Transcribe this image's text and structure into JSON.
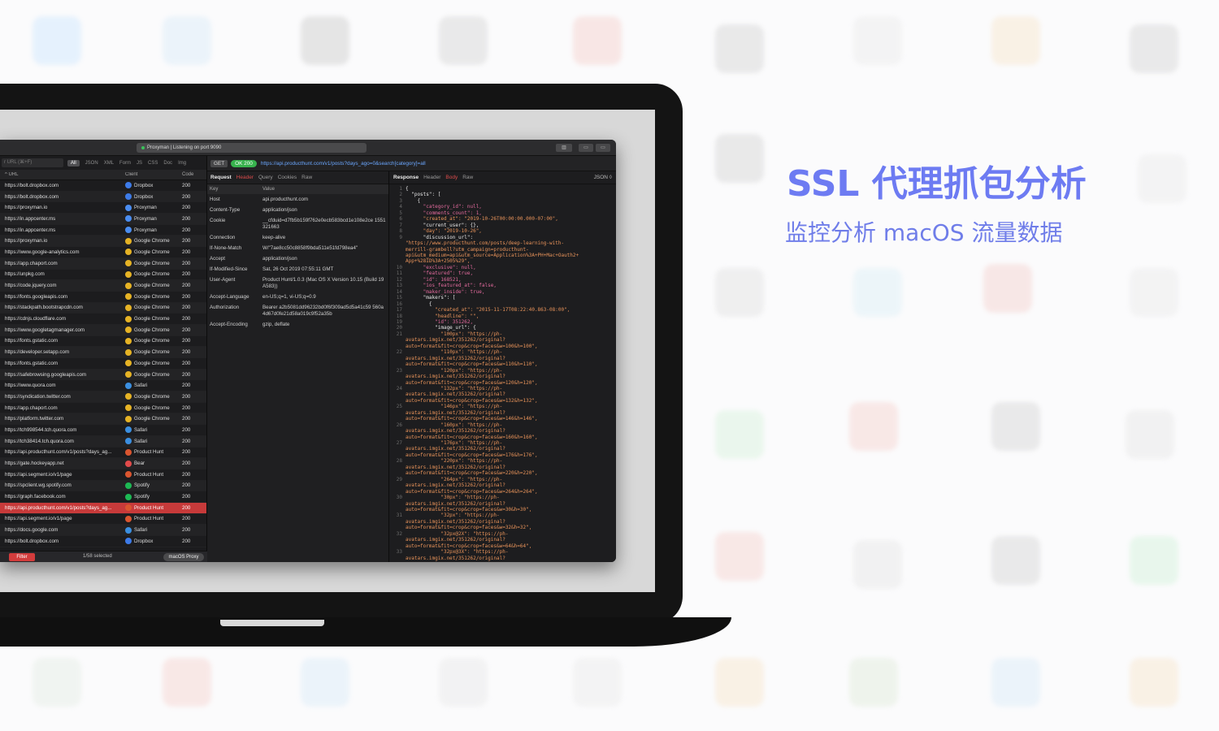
{
  "hero": {
    "headline": "SSL 代理抓包分析",
    "subhead": "监控分析 macOS 流量数据"
  },
  "window": {
    "title": "Proxyman | Listening on port 9090"
  },
  "filterbar": {
    "search_placeholder": "r URL (⌘+F)",
    "tabs": [
      "All",
      "JSON",
      "XML",
      "Form",
      "JS",
      "CSS",
      "Doc",
      "Img"
    ]
  },
  "list": {
    "columns": {
      "url": "URL",
      "client": "Client",
      "code": "Code"
    },
    "rows": [
      {
        "url": "https://bolt.dropbox.com",
        "client": "Dropbox",
        "code": "200"
      },
      {
        "url": "https://bolt.dropbox.com",
        "client": "Dropbox",
        "code": "200"
      },
      {
        "url": "https://proxyman.io",
        "client": "Proxyman",
        "code": "200"
      },
      {
        "url": "https://in.appcenter.ms",
        "client": "Proxyman",
        "code": "200"
      },
      {
        "url": "https://in.appcenter.ms",
        "client": "Proxyman",
        "code": "200"
      },
      {
        "url": "https://proxyman.io",
        "client": "Google Chrome",
        "code": "200"
      },
      {
        "url": "https://www.google-analytics.com",
        "client": "Google Chrome",
        "code": "200"
      },
      {
        "url": "https://app.chaport.com",
        "client": "Google Chrome",
        "code": "200"
      },
      {
        "url": "https://unpkg.com",
        "client": "Google Chrome",
        "code": "200"
      },
      {
        "url": "https://code.jquery.com",
        "client": "Google Chrome",
        "code": "200"
      },
      {
        "url": "https://fonts.googleapis.com",
        "client": "Google Chrome",
        "code": "200"
      },
      {
        "url": "https://stackpath.bootstrapcdn.com",
        "client": "Google Chrome",
        "code": "200"
      },
      {
        "url": "https://cdnjs.cloudflare.com",
        "client": "Google Chrome",
        "code": "200"
      },
      {
        "url": "https://www.googletagmanager.com",
        "client": "Google Chrome",
        "code": "200"
      },
      {
        "url": "https://fonts.gstatic.com",
        "client": "Google Chrome",
        "code": "200"
      },
      {
        "url": "https://developer.setapp.com",
        "client": "Google Chrome",
        "code": "200"
      },
      {
        "url": "https://fonts.gstatic.com",
        "client": "Google Chrome",
        "code": "200"
      },
      {
        "url": "https://safebrowsing.googleapis.com",
        "client": "Google Chrome",
        "code": "200"
      },
      {
        "url": "https://www.quora.com",
        "client": "Safari",
        "code": "200"
      },
      {
        "url": "https://syndication.twitter.com",
        "client": "Google Chrome",
        "code": "200"
      },
      {
        "url": "https://app.chaport.com",
        "client": "Google Chrome",
        "code": "200"
      },
      {
        "url": "https://platform.twitter.com",
        "client": "Google Chrome",
        "code": "200"
      },
      {
        "url": "https://tch998544.tch.quora.com",
        "client": "Safari",
        "code": "200"
      },
      {
        "url": "https://tch38414.tch.quora.com",
        "client": "Safari",
        "code": "200"
      },
      {
        "url": "https://api.producthunt.com/v1/posts?days_ag...",
        "client": "Product Hunt",
        "code": "200"
      },
      {
        "url": "https://gate.hockeyapp.net",
        "client": "Bear",
        "code": "200"
      },
      {
        "url": "https://api.segment.io/v1/page",
        "client": "Product Hunt",
        "code": "200"
      },
      {
        "url": "https://spclient.wg.spotify.com",
        "client": "Spotify",
        "code": "200"
      },
      {
        "url": "https://graph.facebook.com",
        "client": "Spotify",
        "code": "200"
      },
      {
        "url": "https://api.producthunt.com/v1/posts?days_ag...",
        "client": "Product Hunt",
        "code": "200"
      },
      {
        "url": "https://api.segment.io/v1/page",
        "client": "Product Hunt",
        "code": "200"
      },
      {
        "url": "https://docs.google.com",
        "client": "Safari",
        "code": "200"
      },
      {
        "url": "https://bolt.dropbox.com",
        "client": "Dropbox",
        "code": "200"
      }
    ],
    "selected_index": 29
  },
  "client_colors": {
    "Dropbox": "#3d7be8",
    "Proxyman": "#4a8df0",
    "Google Chrome": "#e6b325",
    "Safari": "#3b8fe0",
    "Product Hunt": "#da552f",
    "Bear": "#e24b4b",
    "Spotify": "#1db954"
  },
  "footer": {
    "filter_label": "Filter",
    "selected_text": "1/58 selected",
    "proxy_label": "macOS Proxy"
  },
  "request_bar": {
    "method": "GET",
    "status": "OK 200",
    "url": "https://api.producthunt.com/v1/posts?days_ago=0&search[category]=all"
  },
  "request_pane": {
    "tabs": [
      "Request",
      "Header",
      "Query",
      "Cookies",
      "Raw"
    ],
    "key_header": "Key",
    "value_header": "Value",
    "headers": [
      {
        "key": "Host",
        "value": "api.producthunt.com"
      },
      {
        "key": "Content-Type",
        "value": "application/json"
      },
      {
        "key": "Cookie",
        "value": "__cfduid=d7fb5b159f762e0ecb583bcd1e108e2ce 1551321663"
      },
      {
        "key": "Connection",
        "value": "keep-alive"
      },
      {
        "key": "If-None-Match",
        "value": "W/\"7ae8cc50c8858f9bda511e51fd798ea4\""
      },
      {
        "key": "Accept",
        "value": "application/json"
      },
      {
        "key": "If-Modified-Since",
        "value": "Sat, 26 Oct 2019 07:55:11 GMT"
      },
      {
        "key": "User-Agent",
        "value": "Product Hunt/1.0.3 (Mac OS X Version 10.15 (Build 19A583))"
      },
      {
        "key": "Accept-Language",
        "value": "en-US;q=1, vi-US;q=0.9"
      },
      {
        "key": "Authorization",
        "value": "Bearer a2b5081dd96232bd0f6f309ad5d5a41c59 560a4d67d0fe21d58a019c9f52a35b"
      },
      {
        "key": "Accept-Encoding",
        "value": "gzip, deflate"
      }
    ]
  },
  "response_pane": {
    "tabs": [
      "Response",
      "Header",
      "Body",
      "Raw"
    ],
    "format_label": "JSON ◊",
    "lines": [
      {
        "n": "1",
        "t": "{"
      },
      {
        "n": "2",
        "t": "  \"posts\": ["
      },
      {
        "n": "3",
        "t": "    {"
      },
      {
        "n": "4",
        "t": "      \"category_id\": null,"
      },
      {
        "n": "5",
        "t": "      \"comments_count\": 1,"
      },
      {
        "n": "6",
        "t": "      \"created_at\": \"2019-10-26T00:00:00.000-07:00\","
      },
      {
        "n": "7",
        "t": "      \"current_user\": {},"
      },
      {
        "n": "8",
        "t": "      \"day\": \"2019-10-26\","
      },
      {
        "n": "9",
        "t": "      \"discussion_url\":"
      },
      {
        "n": "",
        "t": "\"https://www.producthunt.com/posts/deep-learning-with-"
      },
      {
        "n": "",
        "t": "merrill-grambell?utm_campaign=producthunt-"
      },
      {
        "n": "",
        "t": "api&utm_medium=api&utm_source=Application%3A+PH+Mac+Oauth2+"
      },
      {
        "n": "",
        "t": "App+%28ID%3A+2505%29\","
      },
      {
        "n": "10",
        "t": "      \"exclusive\": null,"
      },
      {
        "n": "11",
        "t": "      \"featured\": true,"
      },
      {
        "n": "12",
        "t": "      \"id\": 168521,"
      },
      {
        "n": "13",
        "t": "      \"ios_featured_at\": false,"
      },
      {
        "n": "14",
        "t": "      \"maker_inside\": true,"
      },
      {
        "n": "15",
        "t": "      \"makers\": ["
      },
      {
        "n": "16",
        "t": "        {"
      },
      {
        "n": "17",
        "t": "          \"created_at\": \"2015-11-17T08:22:40.863-08:00\","
      },
      {
        "n": "18",
        "t": "          \"headline\": \"\","
      },
      {
        "n": "19",
        "t": "          \"id\": 351262,"
      },
      {
        "n": "20",
        "t": "          \"image_url\": {"
      },
      {
        "n": "21",
        "t": "            \"100px\": \"https://ph-"
      },
      {
        "n": "",
        "t": "avatars.imgix.net/351262/original?"
      },
      {
        "n": "",
        "t": "auto=format&fit=crop&crop=faces&w=100&h=100\","
      },
      {
        "n": "22",
        "t": "            \"110px\": \"https://ph-"
      },
      {
        "n": "",
        "t": "avatars.imgix.net/351262/original?"
      },
      {
        "n": "",
        "t": "auto=format&fit=crop&crop=faces&w=110&h=110\","
      },
      {
        "n": "23",
        "t": "            \"120px\": \"https://ph-"
      },
      {
        "n": "",
        "t": "avatars.imgix.net/351262/original?"
      },
      {
        "n": "",
        "t": "auto=format&fit=crop&crop=faces&w=120&h=120\","
      },
      {
        "n": "24",
        "t": "            \"132px\": \"https://ph-"
      },
      {
        "n": "",
        "t": "avatars.imgix.net/351262/original?"
      },
      {
        "n": "",
        "t": "auto=format&fit=crop&crop=faces&w=132&h=132\","
      },
      {
        "n": "25",
        "t": "            \"146px\": \"https://ph-"
      },
      {
        "n": "",
        "t": "avatars.imgix.net/351262/original?"
      },
      {
        "n": "",
        "t": "auto=format&fit=crop&crop=faces&w=146&h=146\","
      },
      {
        "n": "26",
        "t": "            \"160px\": \"https://ph-"
      },
      {
        "n": "",
        "t": "avatars.imgix.net/351262/original?"
      },
      {
        "n": "",
        "t": "auto=format&fit=crop&crop=faces&w=160&h=160\","
      },
      {
        "n": "27",
        "t": "            \"176px\": \"https://ph-"
      },
      {
        "n": "",
        "t": "avatars.imgix.net/351262/original?"
      },
      {
        "n": "",
        "t": "auto=format&fit=crop&crop=faces&w=176&h=176\","
      },
      {
        "n": "28",
        "t": "            \"220px\": \"https://ph-"
      },
      {
        "n": "",
        "t": "avatars.imgix.net/351262/original?"
      },
      {
        "n": "",
        "t": "auto=format&fit=crop&crop=faces&w=220&h=220\","
      },
      {
        "n": "29",
        "t": "            \"264px\": \"https://ph-"
      },
      {
        "n": "",
        "t": "avatars.imgix.net/351262/original?"
      },
      {
        "n": "",
        "t": "auto=format&fit=crop&crop=faces&w=264&h=264\","
      },
      {
        "n": "30",
        "t": "            \"30px\": \"https://ph-"
      },
      {
        "n": "",
        "t": "avatars.imgix.net/351262/original?"
      },
      {
        "n": "",
        "t": "auto=format&fit=crop&crop=faces&w=30&h=30\","
      },
      {
        "n": "31",
        "t": "            \"32px\": \"https://ph-"
      },
      {
        "n": "",
        "t": "avatars.imgix.net/351262/original?"
      },
      {
        "n": "",
        "t": "auto=format&fit=crop&crop=faces&w=32&h=32\","
      },
      {
        "n": "32",
        "t": "            \"32px@2X\": \"https://ph-"
      },
      {
        "n": "",
        "t": "avatars.imgix.net/351262/original?"
      },
      {
        "n": "",
        "t": "auto=format&fit=crop&crop=faces&w=64&h=64\","
      },
      {
        "n": "33",
        "t": "            \"32px@3X\": \"https://ph-"
      },
      {
        "n": "",
        "t": "avatars.imgix.net/351262/original?"
      }
    ]
  }
}
